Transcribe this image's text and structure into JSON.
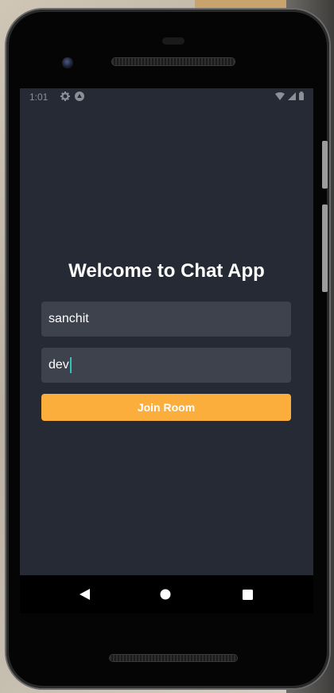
{
  "status_bar": {
    "time": "1:01",
    "left_icons": [
      "settings-icon",
      "android-icon"
    ],
    "right_icons": [
      "wifi-icon",
      "signal-icon",
      "battery-icon"
    ]
  },
  "app": {
    "title": "Welcome to Chat App",
    "name_field": {
      "value": "sanchit"
    },
    "room_field": {
      "value": "dev"
    },
    "join_button": "Join Room"
  },
  "nav_bar": {
    "buttons": [
      "back-icon",
      "home-icon",
      "recents-icon"
    ]
  },
  "colors": {
    "screen_bg": "#252a34",
    "field_bg": "#3e424d",
    "button_bg": "#fbae3c",
    "text": "#ffffff",
    "caret": "#2ec4b6"
  }
}
